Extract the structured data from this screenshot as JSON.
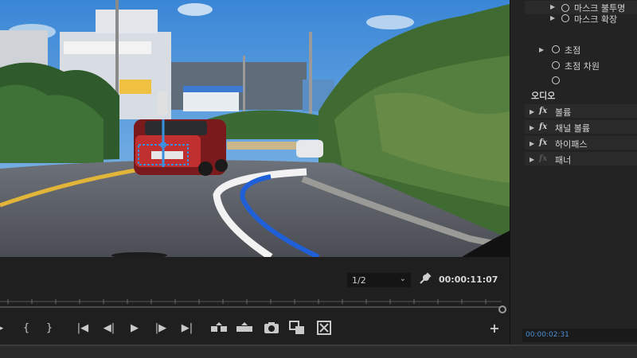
{
  "monitor": {
    "resolution": "1/2",
    "timecode": "00:00:11:07"
  },
  "effects_panel": {
    "rows": [
      {
        "label": "마스크 불투명",
        "type": "stopwatch",
        "indent": 1
      },
      {
        "label": "마스크 확장",
        "type": "stopwatch",
        "indent": 1
      },
      {
        "label": "초점",
        "type": "stopwatch",
        "indent": 1
      },
      {
        "label": "초점 차원",
        "type": "stopwatch",
        "indent": 1
      },
      {
        "label": "",
        "type": "stopwatch",
        "indent": 1
      },
      {
        "label": "오디오",
        "type": "section"
      },
      {
        "label": "볼륨",
        "type": "fx"
      },
      {
        "label": "채널 볼륨",
        "type": "fx"
      },
      {
        "label": "하이패스",
        "type": "fx"
      },
      {
        "label": "패너",
        "type": "fx-dim"
      }
    ],
    "time": "00:00:02:31"
  },
  "transport_icons": [
    "mark-in-icon",
    "mark-out-icon",
    "go-to-in-icon",
    "step-back-icon",
    "play-icon",
    "step-forward-icon",
    "go-to-out-icon",
    "insert-icon",
    "overwrite-icon",
    "export-frame-icon",
    "comparison-icon",
    "multicam-icon",
    "add-button-icon"
  ]
}
